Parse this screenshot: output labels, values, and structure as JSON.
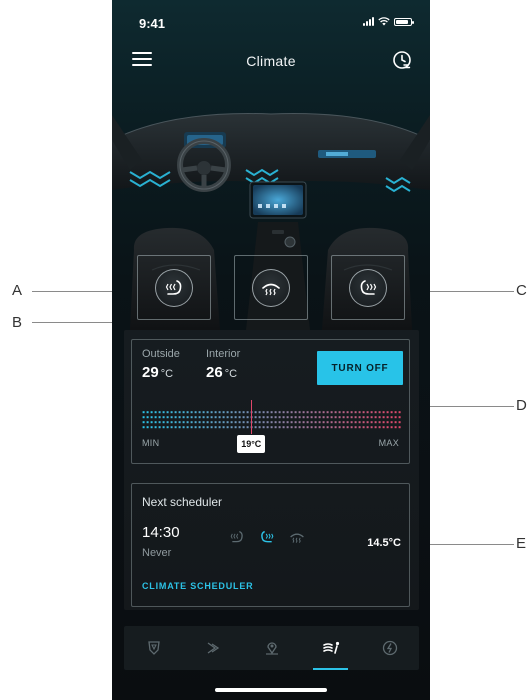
{
  "status_bar": {
    "time": "9:41",
    "battery_level": 0.85
  },
  "header": {
    "title": "Climate",
    "menu_icon": "hamburger-menu-icon",
    "schedule_icon": "clock-schedule-icon"
  },
  "seats": [
    {
      "id": "driver-seat-heating",
      "icon": "seat-heat-icon"
    },
    {
      "id": "front-defrost",
      "icon": "defrost-icon"
    },
    {
      "id": "passenger-seat-heating",
      "icon": "seat-heat-icon"
    }
  ],
  "climate": {
    "outside_label": "Outside",
    "outside_value": "29",
    "interior_label": "Interior",
    "interior_value": "26",
    "unit": "°C",
    "turn_off_label": "TURN OFF",
    "set_temperature": "19°C",
    "set_fraction": 0.42,
    "min_label": "MIN",
    "max_label": "MAX"
  },
  "scheduler": {
    "title": "Next scheduler",
    "time": "14:30",
    "repeat": "Never",
    "temperature": "14.5°C",
    "link_label": "CLIMATE SCHEDULER",
    "icons": [
      "seat-heat-icon",
      "seat-heat-icon",
      "defrost-icon"
    ],
    "active_icon_index": 1
  },
  "bottom_nav": {
    "items": [
      "shield-icon",
      "fan-icon",
      "map-pin-icon",
      "climate-icon",
      "charging-icon"
    ],
    "active_index": 3
  },
  "callouts": {
    "a": "A",
    "b": "B",
    "c": "C",
    "d": "D",
    "e": "E"
  },
  "colors": {
    "accent": "#2cc2e6",
    "cold": "#2cc2e6",
    "hot": "#e0476a",
    "background": "#0b1014"
  }
}
